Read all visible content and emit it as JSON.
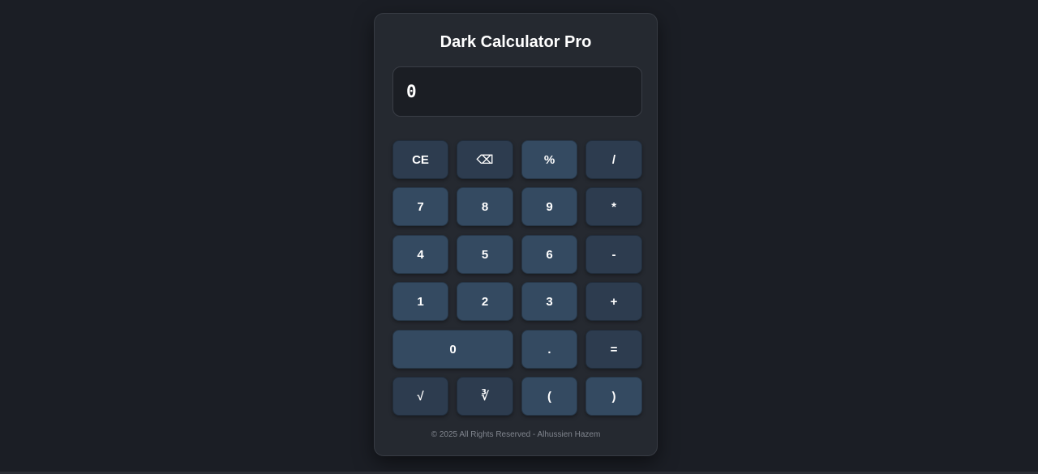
{
  "app": {
    "title": "Dark Calculator Pro"
  },
  "display": {
    "value": "0"
  },
  "buttons": {
    "ce": "CE",
    "backspace": "⌫",
    "percent": "%",
    "divide": "/",
    "seven": "7",
    "eight": "8",
    "nine": "9",
    "multiply": "*",
    "four": "4",
    "five": "5",
    "six": "6",
    "minus": "-",
    "one": "1",
    "two": "2",
    "three": "3",
    "plus": "+",
    "zero": "0",
    "decimal": ".",
    "equals": "=",
    "sqrt": "√",
    "cbrt": "∛",
    "paren_open": "(",
    "paren_close": ")"
  },
  "footer": {
    "text": "© 2025 All Rights Reserved - Alhussien Hazem"
  },
  "colors": {
    "background": "#1b1e25",
    "panel": "#252930",
    "display_bg": "#1b1e24",
    "number_button": "#344a61",
    "function_button": "#2d3c4f",
    "text": "#ffffff",
    "footer_text": "#80858e"
  }
}
